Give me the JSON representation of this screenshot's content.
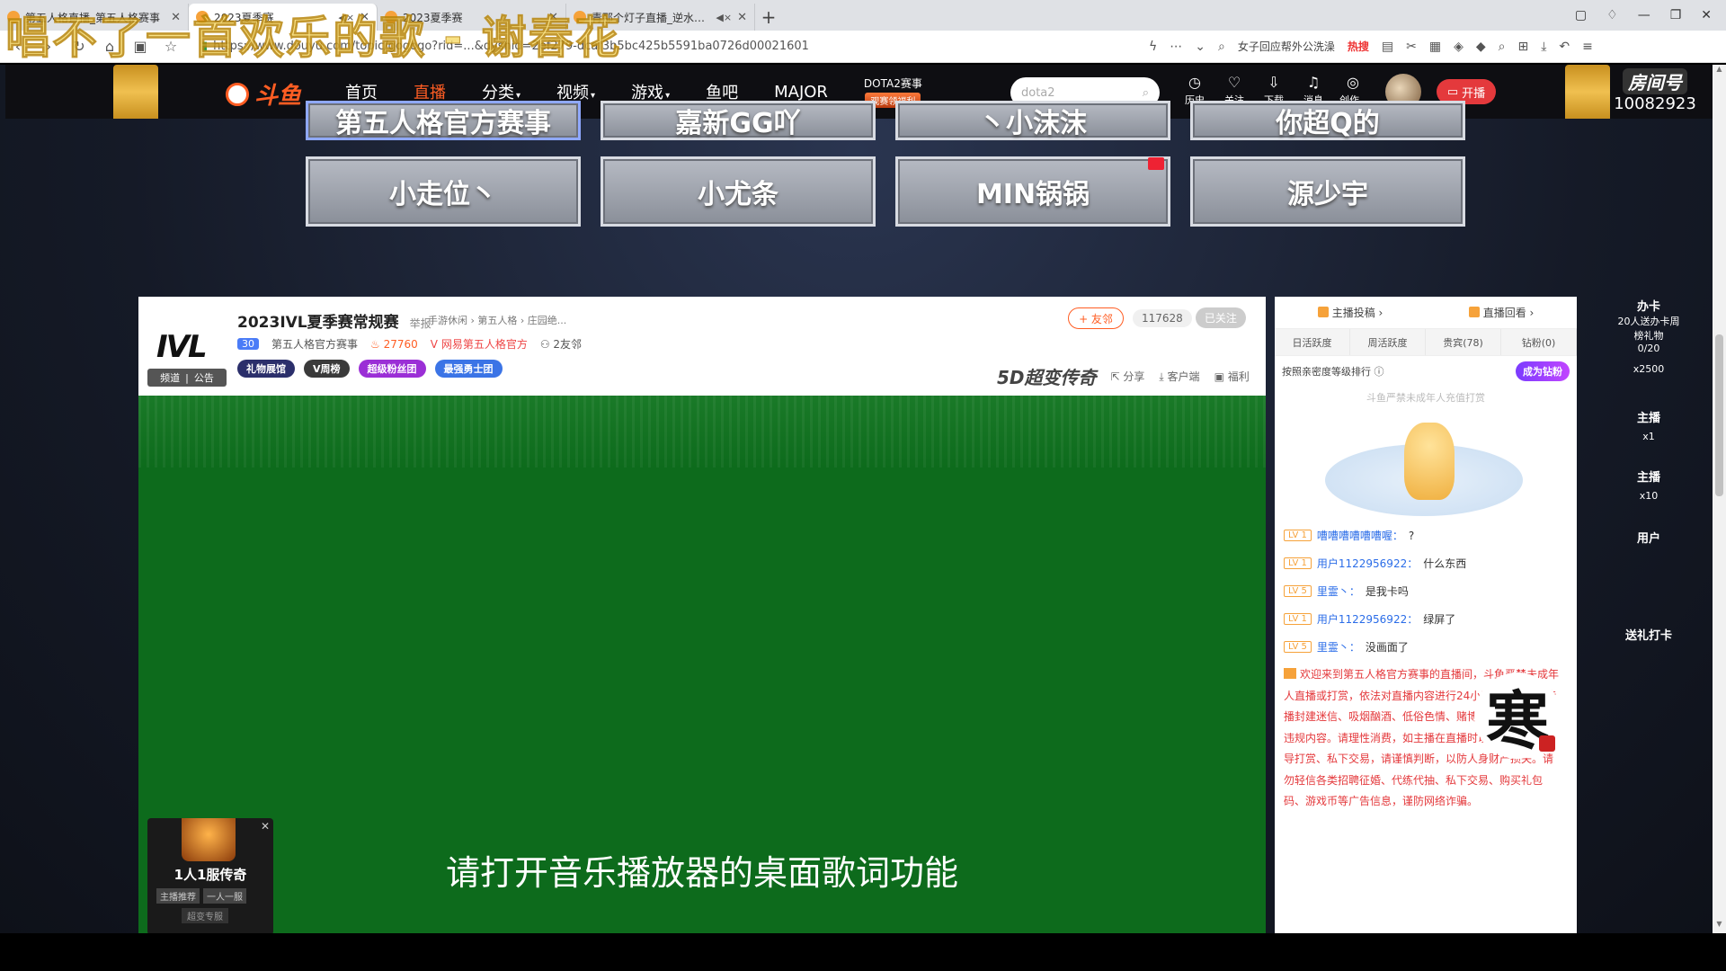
{
  "lyric_overlay": "唱不了一首欢乐的歌 - 谢春花",
  "browser": {
    "tabs": [
      {
        "title": "第五人格直播_第五人格赛事",
        "muted": false
      },
      {
        "title": "2023夏季赛",
        "muted": true
      },
      {
        "title": "2023夏季赛",
        "muted": false
      },
      {
        "title": "青那个灯子直播_逆水寒手",
        "muted": true
      }
    ],
    "new_tab": "+",
    "url": "https://www.douyu.com/topic/gogogo?rid=...&dyshid=2ef279-dcaf3b5bc425b5591ba0726d00021601",
    "search_hint": "女子回应帮外公洗澡",
    "hot_label": "热搜"
  },
  "site": {
    "logo_text": "斗鱼",
    "nav": [
      {
        "label": "首页",
        "active": false,
        "caret": false
      },
      {
        "label": "直播",
        "active": true,
        "caret": false
      },
      {
        "label": "分类",
        "active": false,
        "caret": true
      },
      {
        "label": "视频",
        "active": false,
        "caret": true
      },
      {
        "label": "游戏",
        "active": false,
        "caret": true
      },
      {
        "label": "鱼吧",
        "active": false,
        "caret": false
      },
      {
        "label": "MAJOR",
        "active": false,
        "caret": false
      }
    ],
    "dota_label": "DOTA2赛事",
    "dota_badge": "观赛领福利",
    "search_placeholder": "dota2",
    "header_icons": [
      {
        "label": "历史",
        "icon": "clock-icon",
        "glyph": "◷"
      },
      {
        "label": "关注",
        "icon": "heart-icon",
        "glyph": "♡"
      },
      {
        "label": "下载",
        "icon": "download-icon",
        "glyph": "⇩"
      },
      {
        "label": "消息",
        "icon": "bell-icon",
        "glyph": "♫"
      },
      {
        "label": "创作中心",
        "icon": "bulb-icon",
        "glyph": "◎"
      }
    ],
    "open_live_label": "开播",
    "room_label": "房间号",
    "room_number": "10082923"
  },
  "tiles": {
    "row1": [
      "第五人格官方赛事",
      "嘉新GG吖",
      "丶小沫沫",
      "你超Q的"
    ],
    "row2": [
      "小走位丶",
      "小尤条",
      "MIN锅锅",
      "源少宇"
    ]
  },
  "room": {
    "logo": "IVL",
    "title": "2023IVL夏季赛常规赛",
    "report": "举报",
    "crumbs": "手游休闲 › 第五人格 › 庄园绝...",
    "level": "30",
    "anchor": "第五人格官方赛事",
    "hot": "27760",
    "verify": "网易第五人格官方",
    "friends": "2友邻",
    "channel": "频道",
    "notice": "公告",
    "badges": [
      {
        "label": "礼物展馆",
        "color": "#2b2f6b"
      },
      {
        "label": "V周榜",
        "color": "#3a3a3a"
      },
      {
        "label": "超级粉丝团",
        "color": "#9b2fd6"
      },
      {
        "label": "最强勇士团",
        "color": "#3b74e6"
      }
    ],
    "follow_label": "+ 友邻",
    "fans_count": "117628",
    "followed_label": "已关注",
    "brand": "5D超变传奇",
    "actions": [
      "分享",
      "客户端",
      "福利"
    ],
    "lyric_hint": "请打开音乐播放器的桌面歌词功能",
    "promo": {
      "title": "1人1服传奇",
      "tags": [
        "主播推荐",
        "一人一服"
      ],
      "sub": "超变专服"
    }
  },
  "side": {
    "top_links": [
      "主播投稿 ›",
      "直播回看 ›"
    ],
    "tabs": [
      "日活跃度",
      "周活跃度",
      "贵宾(78)",
      "钻粉(0)"
    ],
    "rank_label": "按照亲密度等级排行",
    "become_diamond": "成为钻粉",
    "warn_top": "斗鱼严禁未成年人充值打赏",
    "chat": [
      {
        "lv": "LV 1",
        "user": "嘈嘈嘈嘈嘈嘈喔：",
        "text": "?"
      },
      {
        "lv": "LV 1",
        "user": "用户1122956922：",
        "text": "什么东西"
      },
      {
        "lv": "LV 5",
        "user": "里霊丶：",
        "text": "是我卡吗"
      },
      {
        "lv": "LV 1",
        "user": "用户1122956922：",
        "text": "绿屏了"
      },
      {
        "lv": "LV 5",
        "user": "里霊丶：",
        "text": "没画面了"
      }
    ],
    "system_msg": "欢迎来到第五人格官方赛事的直播间，斗鱼严禁未成年人直播或打赏，依法对直播内容进行24小时巡查，禁止传播封建迷信、吸烟酗酒、低俗色情、赌博诈骗等任何违法违规内容。请理性消费，如主播在直播时以不正当方式诱导打赏、私下交易，请谨慎判断，以防人身财产损失。请勿轻信各类招聘征婚、代练代抽、私下交易、购买礼包码、游戏币等广告信息，谨防网络诈骗。",
    "calligraphy": "寒"
  },
  "right_rail": [
    {
      "label": "办卡",
      "lines": [
        "20人送办卡周",
        "榜礼物",
        "0/20",
        "x2500"
      ]
    },
    {
      "label": "主播",
      "lines": [
        "x1"
      ]
    },
    {
      "label": "主播",
      "lines": [
        "x10"
      ]
    },
    {
      "label": "用户",
      "lines": []
    },
    {
      "label": "送礼打卡",
      "lines": []
    }
  ]
}
